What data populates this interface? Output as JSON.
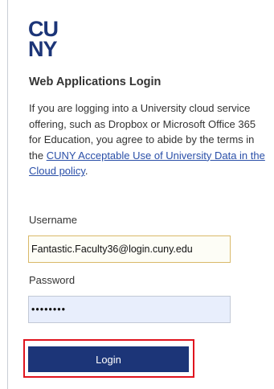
{
  "brand": {
    "logo_icon": "cuny-logo-icon",
    "logo_text_line1": "CU",
    "logo_text_line2": "NY",
    "color": "#1c3578"
  },
  "title": "Web Applications Login",
  "notice": {
    "line1": "If you are logging into a University cloud service",
    "line2": "offering, such as Dropbox or Microsoft Office 365",
    "line3": "for Education, you agree to abide by the terms in",
    "line4_prefix": "the ",
    "link_part1": "CUNY Acceptable Use of University Data in the",
    "link_part2": "Cloud policy",
    "suffix": "."
  },
  "username": {
    "label": "Username",
    "value": "Fantastic.Faculty36@login.cuny.edu"
  },
  "password": {
    "label": "Password",
    "value": "••••••••"
  },
  "login_button": {
    "label": "Login",
    "color": "#1c3578"
  },
  "highlight_color": "#e0141e"
}
